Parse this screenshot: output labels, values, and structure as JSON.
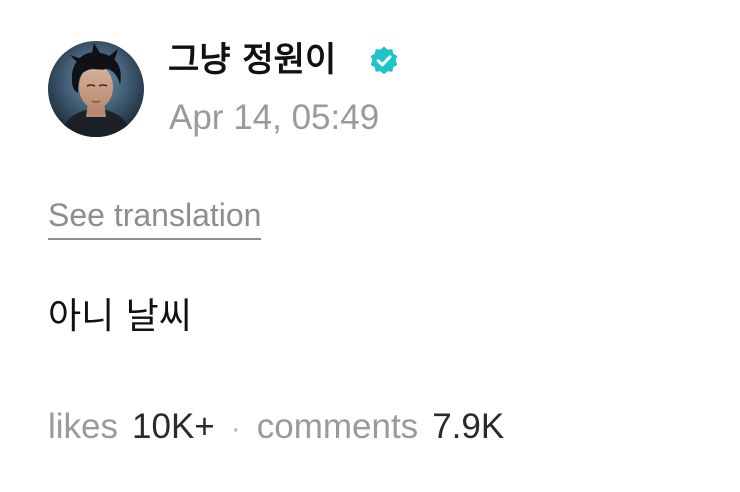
{
  "post": {
    "author": {
      "name": "그냥 정원이",
      "verified": true,
      "avatar": "profile-photo"
    },
    "timestamp": "Apr 14, 05:49",
    "translation_link": "See translation",
    "body": "아니 날씨",
    "stats": {
      "likes_label": "likes",
      "likes_value": "10K+",
      "separator": "·",
      "comments_label": "comments",
      "comments_value": "7.9K"
    }
  },
  "colors": {
    "verified_badge": "#1fc4c9",
    "text_primary": "#111111",
    "text_secondary": "#9a9a9a"
  },
  "icons": {
    "verified": "verified-check-badge-icon"
  }
}
